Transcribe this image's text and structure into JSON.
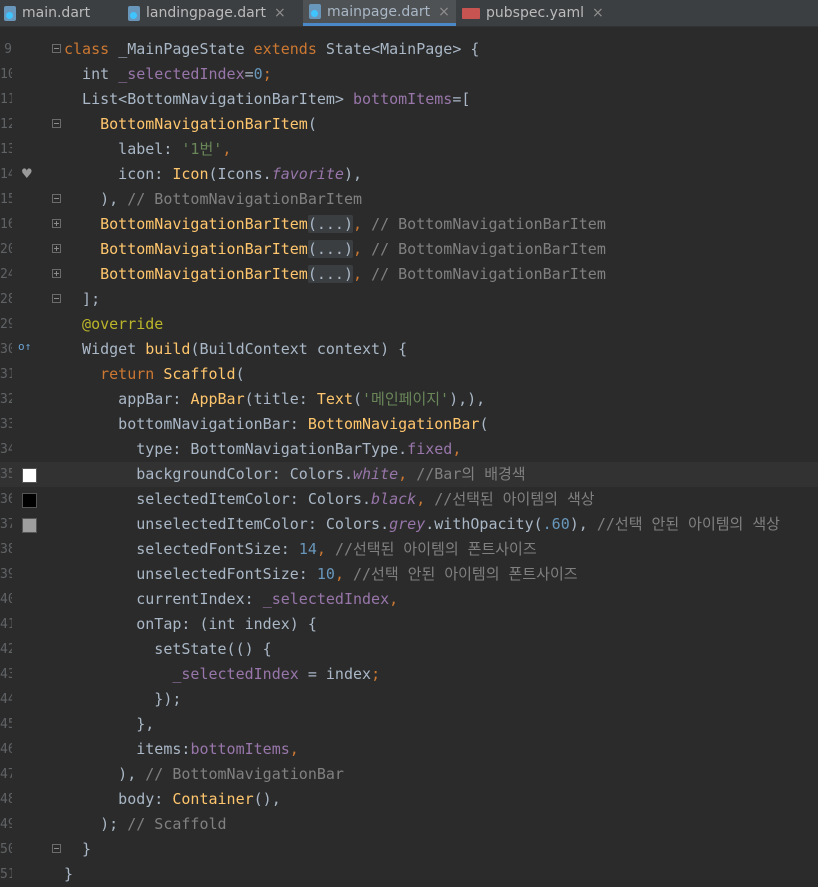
{
  "tabs": [
    {
      "label": "main.dart",
      "close": "×",
      "icon": "dart-file-icon"
    },
    {
      "label": "landingpage.dart",
      "close": "×",
      "icon": "dart-file-icon"
    },
    {
      "label": "mainpage.dart",
      "close": "×",
      "icon": "dart-file-icon",
      "active": true
    },
    {
      "label": "pubspec.yaml",
      "close": "×",
      "icon": "yaml-file-icon"
    }
  ],
  "gutter_colors": {
    "white": "#ffffff",
    "black": "#000000",
    "grey": "#9e9e9e"
  },
  "lines": [
    {
      "n": "9",
      "tokens": [
        [
          "kw",
          "class "
        ],
        [
          "ty",
          "_MainPageState "
        ],
        [
          "kw",
          "extends "
        ],
        [
          "ty",
          "State<MainPage> {"
        ]
      ]
    },
    {
      "n": "10",
      "tokens": [
        [
          "ty",
          "  int "
        ],
        [
          "fld",
          "_selectedIndex"
        ],
        [
          "ty",
          "="
        ],
        [
          "num",
          "0"
        ],
        [
          "kw",
          ";"
        ]
      ]
    },
    {
      "n": "11",
      "tokens": [
        [
          "ty",
          "  List<BottomNavigationBarItem> "
        ],
        [
          "fld",
          "bottomItems"
        ],
        [
          "ty",
          "=["
        ]
      ]
    },
    {
      "n": "12",
      "tokens": [
        [
          "cls",
          "    BottomNavigationBarItem"
        ],
        [
          "ty",
          "("
        ]
      ]
    },
    {
      "n": "13",
      "tokens": [
        [
          "ty",
          "      label: "
        ],
        [
          "str",
          "'1번'"
        ],
        [
          "kw",
          ","
        ]
      ]
    },
    {
      "n": "14",
      "tokens": [
        [
          "ty",
          "      icon: "
        ],
        [
          "cls",
          "Icon"
        ],
        [
          "ty",
          "(Icons."
        ],
        [
          "ital",
          "favorite"
        ],
        [
          "ty",
          "),"
        ]
      ]
    },
    {
      "n": "15",
      "tokens": [
        [
          "ty",
          "    ), "
        ],
        [
          "cmt",
          "// BottomNavigationBarItem"
        ]
      ]
    },
    {
      "n": "16",
      "tokens": [
        [
          "cls",
          "    BottomNavigationBarItem"
        ],
        [
          "ph",
          "(...)"
        ],
        [
          "kw",
          ", "
        ],
        [
          "cmt",
          "// BottomNavigationBarItem"
        ]
      ]
    },
    {
      "n": "20",
      "tokens": [
        [
          "cls",
          "    BottomNavigationBarItem"
        ],
        [
          "ph",
          "(...)"
        ],
        [
          "kw",
          ", "
        ],
        [
          "cmt",
          "// BottomNavigationBarItem"
        ]
      ]
    },
    {
      "n": "24",
      "tokens": [
        [
          "cls",
          "    BottomNavigationBarItem"
        ],
        [
          "ph",
          "(...)"
        ],
        [
          "kw",
          ", "
        ],
        [
          "cmt",
          "// BottomNavigationBarItem"
        ]
      ]
    },
    {
      "n": "28",
      "tokens": [
        [
          "ty",
          "  ];"
        ]
      ]
    },
    {
      "n": "29",
      "tokens": [
        [
          "ann",
          "  @override"
        ]
      ]
    },
    {
      "n": "30",
      "tokens": [
        [
          "ty",
          "  Widget "
        ],
        [
          "fn",
          "build"
        ],
        [
          "ty",
          "(BuildContext context) {"
        ]
      ]
    },
    {
      "n": "31",
      "tokens": [
        [
          "kw",
          "    return "
        ],
        [
          "cls",
          "Scaffold"
        ],
        [
          "ty",
          "("
        ]
      ]
    },
    {
      "n": "32",
      "tokens": [
        [
          "ty",
          "      appBar: "
        ],
        [
          "cls",
          "AppBar"
        ],
        [
          "ty",
          "(title: "
        ],
        [
          "cls",
          "Text"
        ],
        [
          "ty",
          "("
        ],
        [
          "str",
          "'메인페이지'"
        ],
        [
          "ty",
          "),),"
        ]
      ]
    },
    {
      "n": "33",
      "tokens": [
        [
          "ty",
          "      bottomNavigationBar: "
        ],
        [
          "cls",
          "BottomNavigationBar"
        ],
        [
          "ty",
          "("
        ]
      ]
    },
    {
      "n": "34",
      "tokens": [
        [
          "ty",
          "        type: BottomNavigationBarType."
        ],
        [
          "fld",
          "fixed"
        ],
        [
          "kw",
          ","
        ]
      ]
    },
    {
      "n": "35",
      "tokens": [
        [
          "ty",
          "        backgroundColor: Colors."
        ],
        [
          "ital",
          "white"
        ],
        [
          "kw",
          ", "
        ],
        [
          "cmt",
          "//Bar의 배경색"
        ]
      ]
    },
    {
      "n": "36",
      "tokens": [
        [
          "ty",
          "        selectedItemColor: Colors."
        ],
        [
          "ital",
          "black"
        ],
        [
          "kw",
          ", "
        ],
        [
          "cmt",
          "//선택된 아이템의 색상"
        ]
      ]
    },
    {
      "n": "37",
      "tokens": [
        [
          "ty",
          "        unselectedItemColor: Colors."
        ],
        [
          "ital",
          "grey"
        ],
        [
          "ty",
          ".withOpacity("
        ],
        [
          "num",
          ".60"
        ],
        [
          "ty",
          "), "
        ],
        [
          "cmt",
          "//선택 안된 아이템의 색상"
        ]
      ]
    },
    {
      "n": "38",
      "tokens": [
        [
          "ty",
          "        selectedFontSize: "
        ],
        [
          "num",
          "14"
        ],
        [
          "kw",
          ", "
        ],
        [
          "cmt",
          "//선택된 아이템의 폰트사이즈"
        ]
      ]
    },
    {
      "n": "39",
      "tokens": [
        [
          "ty",
          "        unselectedFontSize: "
        ],
        [
          "num",
          "10"
        ],
        [
          "kw",
          ", "
        ],
        [
          "cmt",
          "//선택 안된 아이템의 폰트사이즈"
        ]
      ]
    },
    {
      "n": "40",
      "tokens": [
        [
          "ty",
          "        currentIndex: "
        ],
        [
          "fld",
          "_selectedIndex"
        ],
        [
          "kw",
          ","
        ]
      ]
    },
    {
      "n": "41",
      "tokens": [
        [
          "ty",
          "        onTap: (int index) {"
        ]
      ]
    },
    {
      "n": "42",
      "tokens": [
        [
          "ty",
          "          setState(() {"
        ]
      ]
    },
    {
      "n": "43",
      "tokens": [
        [
          "fld",
          "            _selectedIndex "
        ],
        [
          "ty",
          "= index"
        ],
        [
          "kw",
          ";"
        ]
      ]
    },
    {
      "n": "44",
      "tokens": [
        [
          "ty",
          "          });"
        ]
      ]
    },
    {
      "n": "45",
      "tokens": [
        [
          "ty",
          "        },"
        ]
      ]
    },
    {
      "n": "46",
      "tokens": [
        [
          "ty",
          "        items:"
        ],
        [
          "fld",
          "bottomItems"
        ],
        [
          "kw",
          ","
        ]
      ]
    },
    {
      "n": "47",
      "tokens": [
        [
          "ty",
          "      ), "
        ],
        [
          "cmt",
          "// BottomNavigationBar"
        ]
      ]
    },
    {
      "n": "48",
      "tokens": [
        [
          "ty",
          "      body: "
        ],
        [
          "cls",
          "Container"
        ],
        [
          "ty",
          "(),"
        ]
      ]
    },
    {
      "n": "49",
      "tokens": [
        [
          "ty",
          "    ); "
        ],
        [
          "cmt",
          "// Scaffold"
        ]
      ]
    },
    {
      "n": "50",
      "tokens": [
        [
          "ty",
          "  }"
        ]
      ]
    },
    {
      "n": "51",
      "tokens": [
        [
          "ty",
          "}"
        ]
      ]
    }
  ]
}
